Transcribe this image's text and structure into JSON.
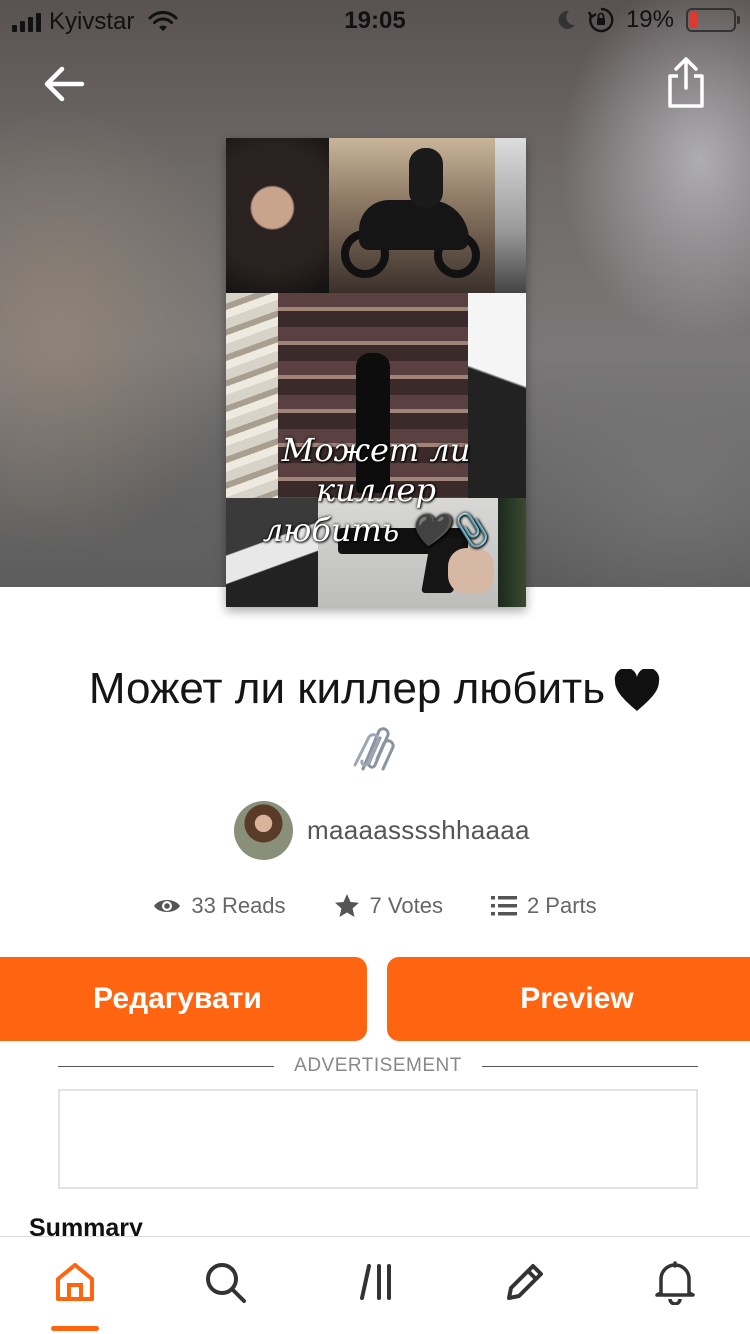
{
  "status_bar": {
    "carrier": "Kyivstar",
    "time": "19:05",
    "battery_percent": "19%",
    "battery_level": 0.19,
    "icons": [
      "signal-icon",
      "wifi-icon",
      "moon-icon",
      "rotation-lock-icon",
      "battery-icon"
    ]
  },
  "nav": {
    "back_icon": "arrow-left-icon",
    "share_icon": "share-icon"
  },
  "cover": {
    "title_line1": "Может ли киллер",
    "title_line2": "любить 🖤📎"
  },
  "story": {
    "title": "Может ли киллер любить",
    "title_emoji": [
      "black-heart-icon",
      "paperclips-icon"
    ]
  },
  "author": {
    "name": "maaaasssshhaaaa"
  },
  "stats": {
    "reads": "33 Reads",
    "votes": "7 Votes",
    "parts": "2 Parts"
  },
  "buttons": {
    "edit": "Редагувати",
    "preview": "Preview"
  },
  "ad": {
    "label": "ADVERTISEMENT"
  },
  "summary": {
    "heading": "Summary"
  },
  "tabbar": {
    "items": [
      "home-icon",
      "search-icon",
      "library-icon",
      "write-icon",
      "notifications-icon"
    ],
    "active": "home-icon"
  },
  "colors": {
    "accent": "#ff6410",
    "battery_low": "#e0382f"
  }
}
